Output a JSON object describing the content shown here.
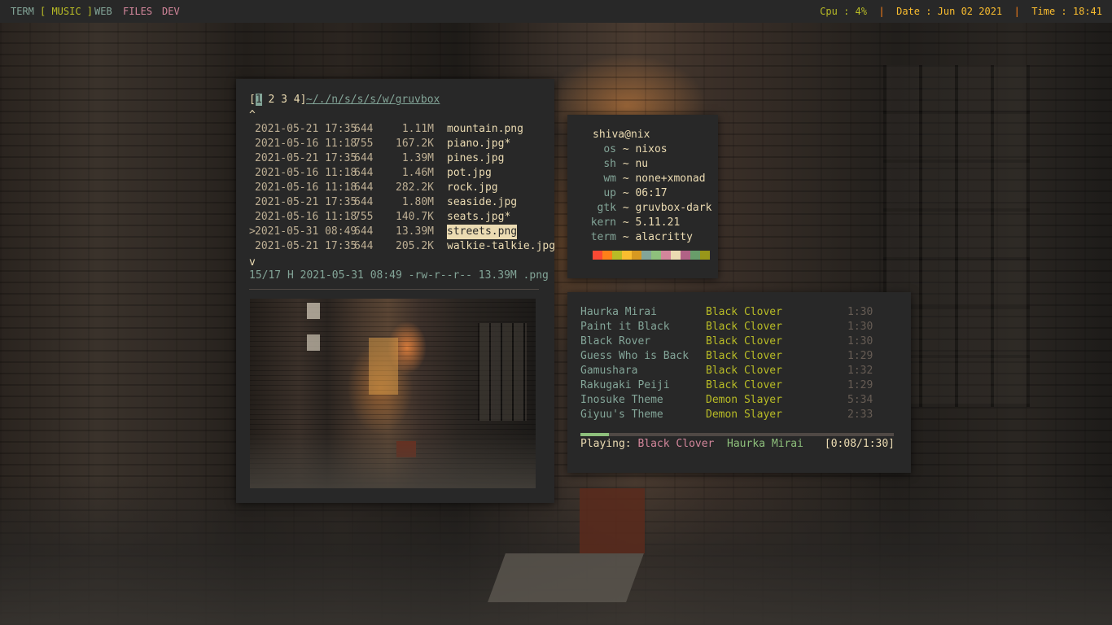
{
  "topbar": {
    "workspaces": [
      {
        "label": "TERM",
        "color": "#83a598"
      },
      {
        "label": "[ MUSIC ]",
        "color": "#b8bb26"
      },
      {
        "label": "WEB",
        "color": "#83a598"
      },
      {
        "label": "FILES",
        "color": "#d3869b"
      },
      {
        "label": "DEV",
        "color": "#d3869b"
      }
    ],
    "cpu": "Cpu : 4%",
    "date": "Date : Jun 02 2021",
    "time": "Time : 18:41",
    "separator": "|"
  },
  "file_manager": {
    "tabs_prefix": "[",
    "tabs": [
      "1",
      "2",
      "3",
      "4"
    ],
    "tabs_suffix": "]",
    "path": "~/./n/s/s/s/w/gruvbox",
    "top_marker": "^",
    "bottom_marker": "v",
    "files": [
      {
        "date": "2021-05-21 17:35",
        "perm": "644",
        "size": "1.11M",
        "name": "mountain.png",
        "selected": false
      },
      {
        "date": "2021-05-16 11:18",
        "perm": "755",
        "size": "167.2K",
        "name": "piano.jpg*",
        "selected": false
      },
      {
        "date": "2021-05-21 17:35",
        "perm": "644",
        "size": "1.39M",
        "name": "pines.jpg",
        "selected": false
      },
      {
        "date": "2021-05-16 11:18",
        "perm": "644",
        "size": "1.46M",
        "name": "pot.jpg",
        "selected": false
      },
      {
        "date": "2021-05-16 11:18",
        "perm": "644",
        "size": "282.2K",
        "name": "rock.jpg",
        "selected": false
      },
      {
        "date": "2021-05-21 17:35",
        "perm": "644",
        "size": "1.80M",
        "name": "seaside.jpg",
        "selected": false
      },
      {
        "date": "2021-05-16 11:18",
        "perm": "755",
        "size": "140.7K",
        "name": "seats.jpg*",
        "selected": false
      },
      {
        "date": "2021-05-31 08:49",
        "perm": "644",
        "size": "13.39M",
        "name": "streets.png",
        "selected": true
      },
      {
        "date": "2021-05-21 17:35",
        "perm": "644",
        "size": "205.2K",
        "name": "walkie-talkie.jpg",
        "selected": false
      }
    ],
    "cursor": ">",
    "status_line": "15/17 H 2021-05-31 08:49 -rw-r--r-- 13.39M .png"
  },
  "fetch": {
    "user": "shiva@nix",
    "tilde": "~",
    "entries": [
      {
        "key": "os",
        "value": "nixos"
      },
      {
        "key": "sh",
        "value": "nu"
      },
      {
        "key": "wm",
        "value": "none+xmonad"
      },
      {
        "key": "up",
        "value": "06:17"
      },
      {
        "key": "gtk",
        "value": "gruvbox-dark"
      },
      {
        "key": "kern",
        "value": "5.11.21"
      },
      {
        "key": "term",
        "value": "alacritty"
      }
    ],
    "palette": [
      "#fb4934",
      "#fe8019",
      "#b8bb26",
      "#fabd2f",
      "#d79921",
      "#83a598",
      "#8ec07c",
      "#d3869b",
      "#ebdbb2",
      "#b16286",
      "#689d6a",
      "#98971a"
    ]
  },
  "music": {
    "tracks": [
      {
        "title": "Haurka Mirai",
        "album": "Black Clover",
        "duration": "1:30"
      },
      {
        "title": "Paint it Black",
        "album": "Black Clover",
        "duration": "1:30"
      },
      {
        "title": "Black Rover",
        "album": "Black Clover",
        "duration": "1:30"
      },
      {
        "title": "Guess Who is Back",
        "album": "Black Clover",
        "duration": "1:29"
      },
      {
        "title": "Gamushara",
        "album": "Black Clover",
        "duration": "1:32"
      },
      {
        "title": "Rakugaki Peiji",
        "album": "Black Clover",
        "duration": "1:29"
      },
      {
        "title": "Inosuke Theme",
        "album": "Demon Slayer",
        "duration": "5:34"
      },
      {
        "title": "Giyuu's Theme",
        "album": "Demon Slayer",
        "duration": "2:33"
      }
    ],
    "playing_label": "Playing:",
    "now_album": "Black Clover",
    "now_title": "Haurka Mirai",
    "elapsed": "[0:08/1:30]",
    "progress_fraction": 0.09
  }
}
